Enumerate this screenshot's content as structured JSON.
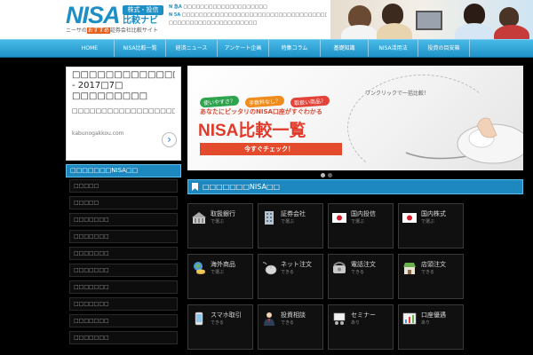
{
  "header": {
    "logo_main": "NISA",
    "logo_tag": "株式・投信",
    "logo_navi": "比較ナビ",
    "logo_sub_pre": "ニーサの",
    "logo_sub_hl": "おすすめ",
    "logo_sub_post": "証券会社比較サイト",
    "news": [
      {
        "mark": "N 急A",
        "text": "□□□□□□□□□□□□□□□□□□□□"
      },
      {
        "mark": "N 5A",
        "text": "□□□□□□□□□□□□□□□□□□□□□□□□□□□□□□□□□□□□□□□□□"
      },
      {
        "mark": "",
        "text": "□□□□□□□□□□□□□□□□□□□□□"
      }
    ]
  },
  "nav": {
    "items": [
      "HOME",
      "NISA比較一覧",
      "経済ニュース",
      "アンケート企画",
      "特集コラム",
      "基礎知識",
      "NISA活用法",
      "投資の目安箱"
    ]
  },
  "ad": {
    "title": "□□□□□□□□□□□□□ - 2017□7□ □□□□□□□□□",
    "desc": "□□□□□□□□□□□□□□□□□□□□□□□□□□",
    "url": "kabunogakkou.com",
    "arrow": "›"
  },
  "sidebar": {
    "heading": "□□□□□□□NISA□□",
    "items": [
      "□□□□□",
      "□□□□□",
      "□□□□□□□",
      "□□□□□□□",
      "□□□□□□□",
      "□□□□□□□",
      "□□□□□□□",
      "□□□□□□□",
      "□□□□□□□",
      "□□□□□□□"
    ]
  },
  "banner": {
    "tags": [
      "使いやすさ？",
      "手数料なし？",
      "取扱い商品？"
    ],
    "tag_colors": [
      "#2fa44f",
      "#f08c1c",
      "#e2443a"
    ],
    "lead": "あなたにピッタリのNISA口座がすぐわかる",
    "title": "NISA比較一覧",
    "cta": "今すぐチェック！",
    "click_text": "ワンクリックで一括比較！"
  },
  "main": {
    "heading": "□□□□□□□NISA□□",
    "categories": [
      {
        "title": "取扱銀行",
        "sub": "で選ぶ",
        "icon": "bank-icon"
      },
      {
        "title": "証券会社",
        "sub": "で選ぶ",
        "icon": "building-icon"
      },
      {
        "title": "国内投信",
        "sub": "で選ぶ",
        "icon": "japan-flag-icon"
      },
      {
        "title": "国内株式",
        "sub": "で選ぶ",
        "icon": "japan-flag-icon"
      },
      {
        "title": "海外商品",
        "sub": "で選ぶ",
        "icon": "globe-coins-icon"
      },
      {
        "title": "ネット注文",
        "sub": "できる",
        "icon": "mouse-icon"
      },
      {
        "title": "電話注文",
        "sub": "できる",
        "icon": "phone-icon"
      },
      {
        "title": "店頭注文",
        "sub": "できる",
        "icon": "store-icon"
      },
      {
        "title": "スマホ取引",
        "sub": "できる",
        "icon": "smartphone-icon"
      },
      {
        "title": "投資相談",
        "sub": "できる",
        "icon": "consultant-icon"
      },
      {
        "title": "セミナー",
        "sub": "あり",
        "icon": "seminar-icon"
      },
      {
        "title": "口座優遇",
        "sub": "あり",
        "icon": "chart-icon"
      }
    ]
  }
}
